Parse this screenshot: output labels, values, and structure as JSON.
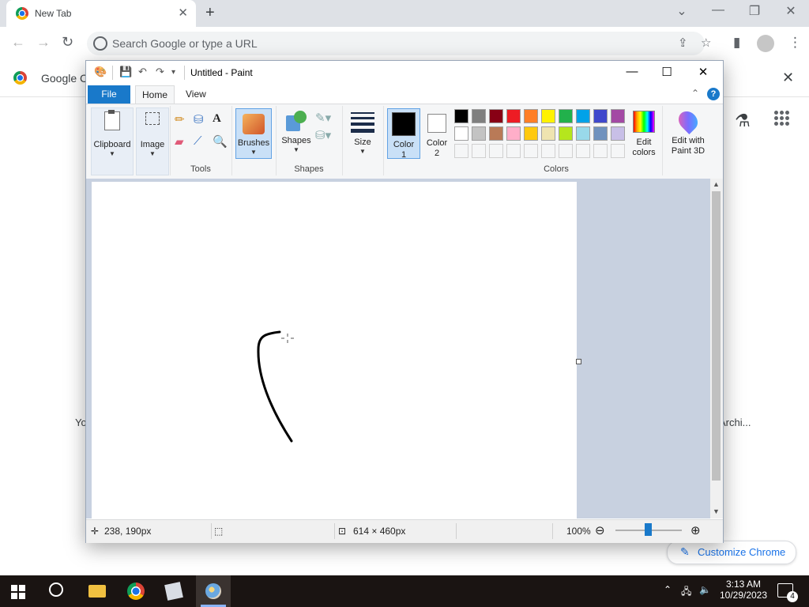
{
  "chrome": {
    "tab_title": "New Tab",
    "omnibox_placeholder": "Search Google or type a URL",
    "bookmark_text": "Google Ch",
    "shortcut_left_text": "Yo",
    "shortcut_right_text": "Archi...",
    "customize_label": "Customize Chrome"
  },
  "paint": {
    "window_title": "Untitled - Paint",
    "tabs": {
      "file": "File",
      "home": "Home",
      "view": "View"
    },
    "groups": {
      "clipboard": "Clipboard",
      "image": "Image",
      "tools": "Tools",
      "brushes": "Brushes",
      "shapes": "Shapes",
      "shapes_group": "Shapes",
      "size": "Size",
      "color1_a": "Color",
      "color1_b": "1",
      "color2_a": "Color",
      "color2_b": "2",
      "colors_group": "Colors",
      "edit_colors_a": "Edit",
      "edit_colors_b": "colors",
      "paint3d_a": "Edit with",
      "paint3d_b": "Paint 3D"
    },
    "palette_row1": [
      "#000000",
      "#7f7f7f",
      "#880015",
      "#ed1c24",
      "#ff7f27",
      "#fff200",
      "#22b14c",
      "#00a2e8",
      "#3f48cc",
      "#a349a4"
    ],
    "palette_row2": [
      "#ffffff",
      "#c3c3c3",
      "#b97a57",
      "#ffaec9",
      "#ffc90e",
      "#efe4b0",
      "#b5e61d",
      "#99d9ea",
      "#7092be",
      "#c8bfe7"
    ],
    "primary_color": "#000000",
    "secondary_color": "#ffffff",
    "status": {
      "cursor_pos": "238, 190px",
      "canvas_size": "614 × 460px",
      "zoom": "100%"
    }
  },
  "taskbar": {
    "time": "3:13 AM",
    "date": "10/29/2023",
    "notifications": "4"
  }
}
